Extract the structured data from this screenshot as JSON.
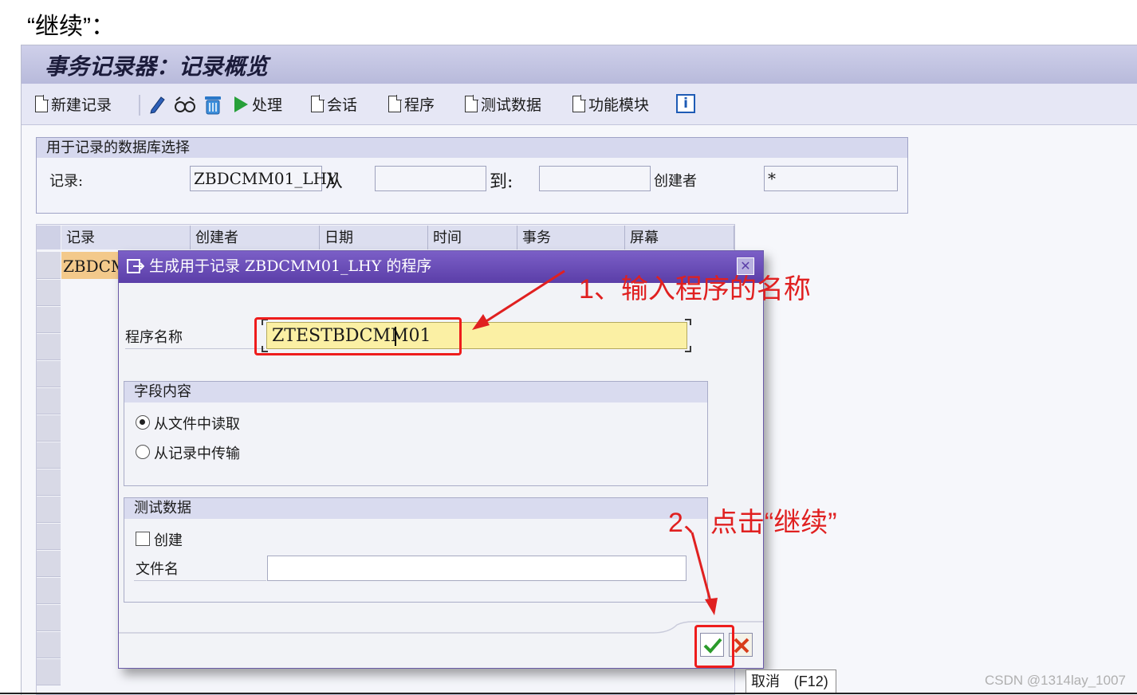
{
  "caption": "“继续”：",
  "window": {
    "title": "事务记录器：记录概览"
  },
  "toolbar": {
    "new_record": "新建记录",
    "process": "处理",
    "session": "会话",
    "program": "程序",
    "test_data": "测试数据",
    "function_module": "功能模块"
  },
  "selection": {
    "header": "用于记录的数据库选择",
    "record_label": "记录:",
    "record_value": "ZBDCMM01_LHY",
    "from_label": "从",
    "to_label": "到:",
    "from_value": "",
    "to_value": "",
    "creator_label": "创建者",
    "creator_value": "*"
  },
  "table": {
    "columns": [
      "记录",
      "创建者",
      "日期",
      "时间",
      "事务",
      "屏幕"
    ],
    "first_cell": "ZBDCMM"
  },
  "dialog": {
    "title": "生成用于记录 ZBDCMM01_LHY 的程序",
    "program_name_label": "程序名称",
    "program_name_value": "ZTESTBDCMM01",
    "field_content_header": "字段内容",
    "radio_read_file": "从文件中读取",
    "radio_transfer_record": "从记录中传输",
    "selected_radio": "从文件中读取",
    "test_data_header": "测试数据",
    "create_label": "创建",
    "create_checked": false,
    "file_name_label": "文件名",
    "file_name_value": ""
  },
  "tooltip": {
    "text": "取消",
    "key": "(F12)"
  },
  "annotations": {
    "step1": "1、输入程序的名称",
    "step2": "2、点击“继续”"
  },
  "watermark": "CSDN @1314lay_1007",
  "colors": {
    "annotation_red": "#e02020",
    "dialog_title": "#6a4fbb",
    "input_highlight": "#fbf0a4"
  }
}
